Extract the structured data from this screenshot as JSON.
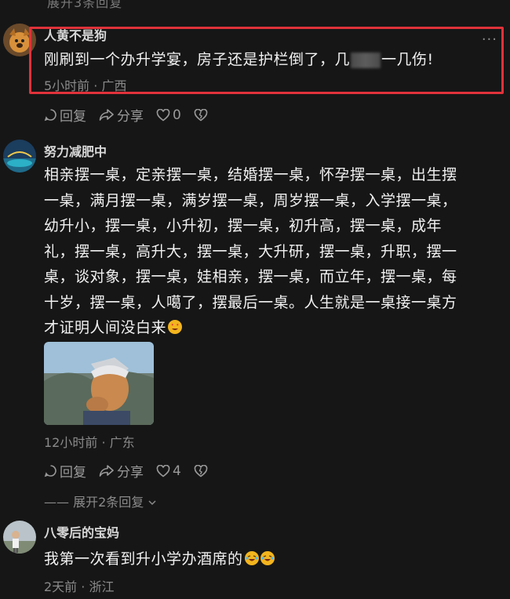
{
  "top": {
    "expand_label": "展开3条回复"
  },
  "comments": [
    {
      "username": "人黄不是狗",
      "text_before": "刚刷到一个办升学宴，房子还是护栏倒了，几",
      "text_after": "一几伤!",
      "meta": "5小时前 · 广西",
      "reply_label": "回复",
      "share_label": "分享",
      "like_count": "0",
      "more_label": "···"
    },
    {
      "username": "努力减肥中",
      "lines": [
        "相亲摆一桌，定亲摆一桌，结婚摆一桌，怀孕摆一桌，出生摆",
        "一桌，满月摆一桌，满岁摆一桌，周岁摆一桌，入学摆一桌，",
        "幼升小，摆一桌，小升初，摆一桌，初升高，摆一桌，成年",
        "礼，摆一桌，高升大，摆一桌，大升研，摆一桌，升职，摆一",
        "桌，谈对象，摆一桌，娃相亲，摆一桌，而立年，摆一桌，每",
        "十岁，摆一桌，人噶了，摆最后一桌。人生就是一桌接一桌方",
        "才证明人间没白来"
      ],
      "meta": "12小时前 · 广东",
      "reply_label": "回复",
      "share_label": "分享",
      "like_count": "4",
      "expand_label": "—— 展开2条回复"
    },
    {
      "username": "八零后的宝妈",
      "text": "我第一次看到升小学办酒席的",
      "meta": "2天前 · 浙江"
    }
  ],
  "colors": {
    "highlight": "#e0323a",
    "background": "#161616"
  }
}
